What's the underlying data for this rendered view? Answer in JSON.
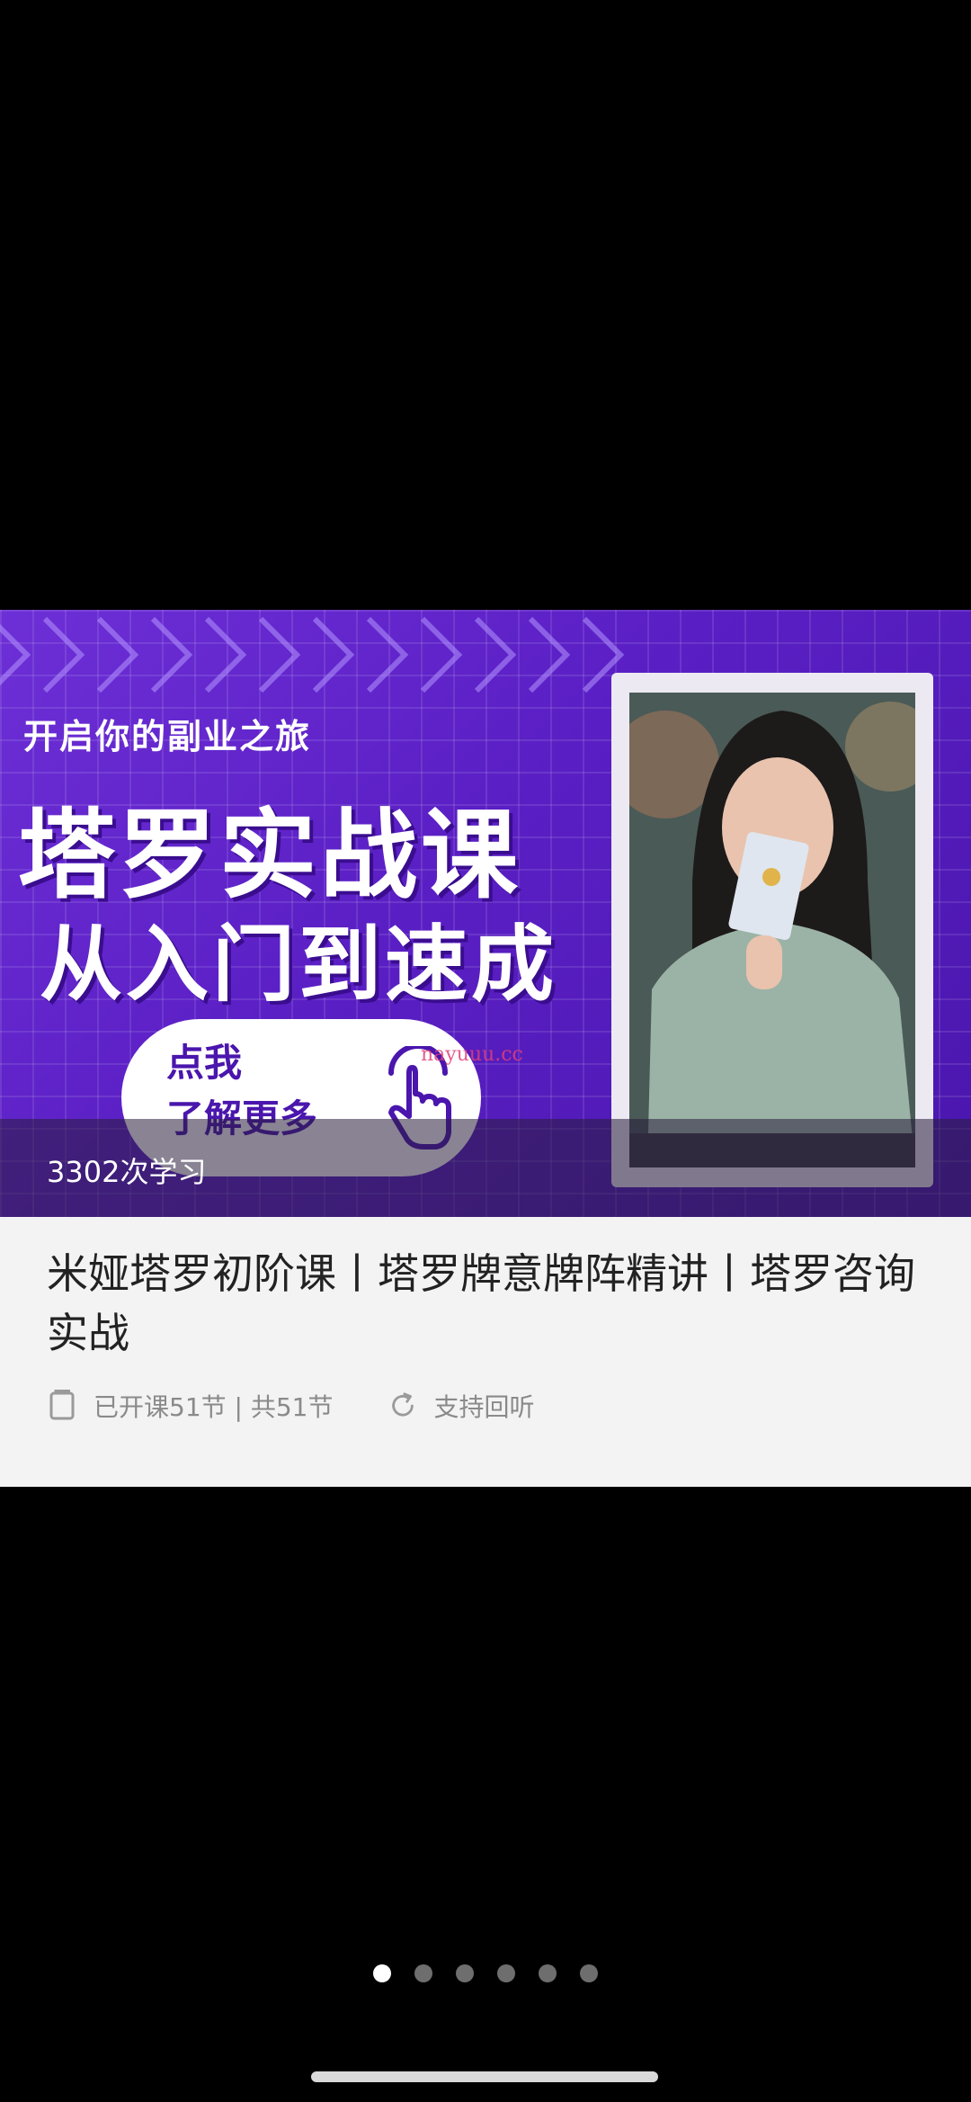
{
  "banner": {
    "tagline": "开启你的副业之旅",
    "title_line1": "塔罗实战课",
    "title_line2": "从入门到速成",
    "cta_line1": "点我",
    "cta_line2": "了解更多",
    "watermark": "nayuuu.cc",
    "view_count": "3302次学习"
  },
  "course": {
    "title": "米娅塔罗初阶课丨塔罗牌意牌阵精讲丨塔罗咨询实战",
    "lessons": "已开课51节 | 共51节",
    "replay": "支持回听"
  },
  "pager": {
    "count": 6,
    "active": 1
  },
  "colors": {
    "banner_purple": "#5a1fc4",
    "info_bg": "#f3f3f3",
    "text": "#222222",
    "meta": "#8a8a8a"
  },
  "icons": [
    "hand-pointer-icon",
    "lesson-doc-icon",
    "replay-icon"
  ]
}
